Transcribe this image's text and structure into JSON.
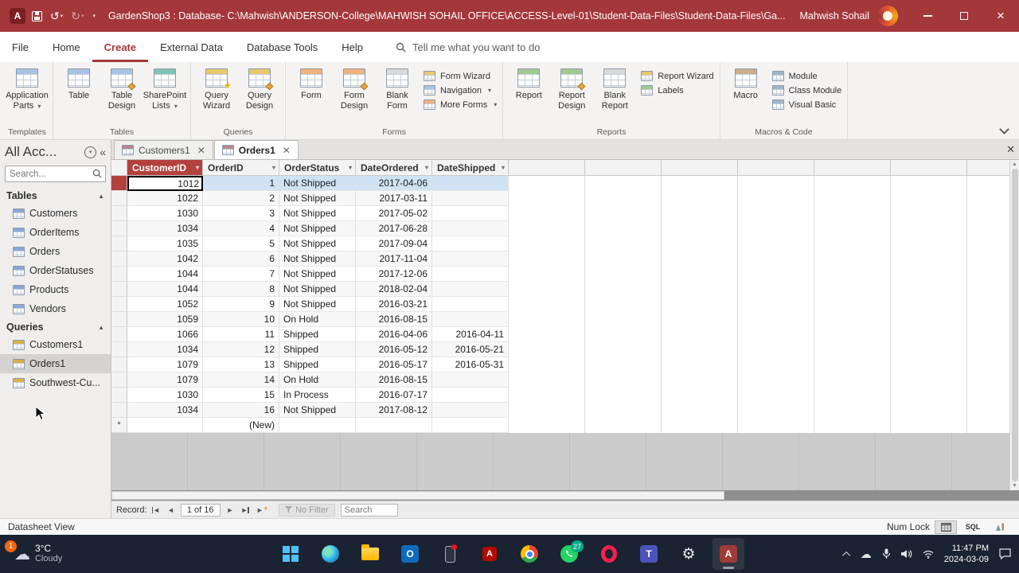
{
  "titlebar": {
    "title": "GardenShop3 : Database- C:\\Mahwish\\ANDERSON-College\\MAHWISH SOHAIL OFFICE\\ACCESS-Level-01\\Student-Data-Files\\Student-Data-Files\\Ga...",
    "user": "Mahwish Sohail"
  },
  "ribbon": {
    "tabs": [
      "File",
      "Home",
      "Create",
      "External Data",
      "Database Tools",
      "Help"
    ],
    "active_tab": "Create",
    "tell_me": "Tell me what you want to do",
    "groups": [
      {
        "label": "Templates",
        "big": [
          {
            "label": "Application Parts",
            "icon": "appparts",
            "caret": true
          }
        ],
        "small": []
      },
      {
        "label": "Tables",
        "big": [
          {
            "label": "Table",
            "icon": "table"
          },
          {
            "label": "Table Design",
            "icon": "tabledesign"
          },
          {
            "label": "SharePoint Lists",
            "icon": "sharepoint",
            "caret": true
          }
        ],
        "small": []
      },
      {
        "label": "Queries",
        "big": [
          {
            "label": "Query Wizard",
            "icon": "querywizard"
          },
          {
            "label": "Query Design",
            "icon": "querydesign"
          }
        ],
        "small": []
      },
      {
        "label": "Forms",
        "big": [
          {
            "label": "Form",
            "icon": "form"
          },
          {
            "label": "Form Design",
            "icon": "formdesign"
          },
          {
            "label": "Blank Form",
            "icon": "blankform"
          }
        ],
        "small": [
          {
            "label": "Form Wizard",
            "icon": "wizard"
          },
          {
            "label": "Navigation",
            "icon": "nav",
            "caret": true
          },
          {
            "label": "More Forms",
            "icon": "more",
            "caret": true
          }
        ]
      },
      {
        "label": "Reports",
        "big": [
          {
            "label": "Report",
            "icon": "report"
          },
          {
            "label": "Report Design",
            "icon": "reportdesign"
          },
          {
            "label": "Blank Report",
            "icon": "blankreport"
          }
        ],
        "small": [
          {
            "label": "Report Wizard",
            "icon": "wizard"
          },
          {
            "label": "Labels",
            "icon": "labels"
          }
        ]
      },
      {
        "label": "Macros & Code",
        "big": [
          {
            "label": "Macro",
            "icon": "macro"
          }
        ],
        "small": [
          {
            "label": "Module",
            "icon": "module"
          },
          {
            "label": "Class Module",
            "icon": "module"
          },
          {
            "label": "Visual Basic",
            "icon": "vb"
          }
        ]
      }
    ]
  },
  "nav": {
    "title": "All Acc...",
    "search_placeholder": "Search...",
    "sections": [
      {
        "label": "Tables",
        "items": [
          "Customers",
          "OrderItems",
          "Orders",
          "OrderStatuses",
          "Products",
          "Vendors"
        ]
      },
      {
        "label": "Queries",
        "items": [
          "Customers1",
          "Orders1",
          "Southwest-Cu..."
        ],
        "selected": "Orders1"
      }
    ]
  },
  "doctabs": [
    {
      "label": "Customers1",
      "active": false
    },
    {
      "label": "Orders1",
      "active": true
    }
  ],
  "datasheet": {
    "columns": [
      "CustomerID",
      "OrderID",
      "OrderStatus",
      "DateOrdered",
      "DateShipped"
    ],
    "selected_column": "CustomerID",
    "rows": [
      [
        "1012",
        "1",
        "Not Shipped",
        "2017-04-06",
        ""
      ],
      [
        "1022",
        "2",
        "Not Shipped",
        "2017-03-11",
        ""
      ],
      [
        "1030",
        "3",
        "Not Shipped",
        "2017-05-02",
        ""
      ],
      [
        "1034",
        "4",
        "Not Shipped",
        "2017-06-28",
        ""
      ],
      [
        "1035",
        "5",
        "Not Shipped",
        "2017-09-04",
        ""
      ],
      [
        "1042",
        "6",
        "Not Shipped",
        "2017-11-04",
        ""
      ],
      [
        "1044",
        "7",
        "Not Shipped",
        "2017-12-06",
        ""
      ],
      [
        "1044",
        "8",
        "Not Shipped",
        "2018-02-04",
        ""
      ],
      [
        "1052",
        "9",
        "Not Shipped",
        "2016-03-21",
        ""
      ],
      [
        "1059",
        "10",
        "On Hold",
        "2016-08-15",
        ""
      ],
      [
        "1066",
        "11",
        "Shipped",
        "2016-04-06",
        "2016-04-11"
      ],
      [
        "1034",
        "12",
        "Shipped",
        "2016-05-12",
        "2016-05-21"
      ],
      [
        "1079",
        "13",
        "Shipped",
        "2016-05-17",
        "2016-05-31"
      ],
      [
        "1079",
        "14",
        "On Hold",
        "2016-08-15",
        ""
      ],
      [
        "1030",
        "15",
        "In Process",
        "2016-07-17",
        ""
      ],
      [
        "1034",
        "16",
        "Not Shipped",
        "2017-08-12",
        ""
      ]
    ],
    "new_row_label": "(New)",
    "active_cell": {
      "row": 0,
      "col": 0
    }
  },
  "recordbar": {
    "label": "Record:",
    "position": "1 of 16",
    "no_filter": "No Filter",
    "search_placeholder": "Search"
  },
  "statusbar": {
    "left": "Datasheet View",
    "numlock": "Num Lock",
    "sql": "SQL"
  },
  "taskbar": {
    "weather": {
      "badge": "1",
      "temp": "3°C",
      "condition": "Cloudy"
    },
    "icons": [
      {
        "name": "start"
      },
      {
        "name": "edge"
      },
      {
        "name": "file-explorer"
      },
      {
        "name": "outlook"
      },
      {
        "name": "phone-link"
      },
      {
        "name": "acrobat"
      },
      {
        "name": "chrome"
      },
      {
        "name": "whatsapp",
        "badge": "27"
      },
      {
        "name": "opera"
      },
      {
        "name": "teams"
      },
      {
        "name": "settings"
      },
      {
        "name": "access",
        "active": true
      }
    ],
    "clock": {
      "time": "11:47 PM",
      "date": "2024-03-09"
    }
  },
  "colors": {
    "accent": "#a4373a",
    "selected_row": "#cfe3f5",
    "taskbar": "#1a2331"
  }
}
